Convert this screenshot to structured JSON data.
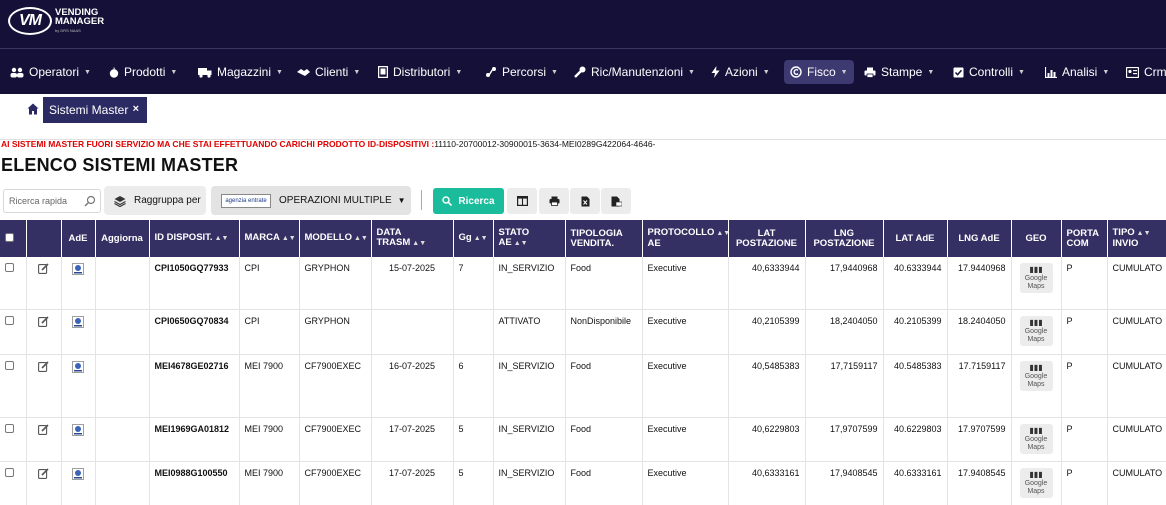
{
  "app": {
    "logo_mark": "VM",
    "logo_line1": "VENDING",
    "logo_line2": "MANAGER",
    "logo_sub": "by DRS NAAS"
  },
  "nav": {
    "items": [
      {
        "label": "Operatori",
        "icon": "users-icon"
      },
      {
        "label": "Prodotti",
        "icon": "apple-icon"
      },
      {
        "label": "Magazzini",
        "icon": "truck-icon"
      },
      {
        "label": "Clienti",
        "icon": "handshake-icon"
      },
      {
        "label": "Distributori",
        "icon": "tablet-icon"
      },
      {
        "label": "Percorsi",
        "icon": "route-icon"
      },
      {
        "label": "Ric/Manutenzioni",
        "icon": "wrench-icon"
      },
      {
        "label": "Azioni",
        "icon": "bolt-icon"
      },
      {
        "label": "Fisco",
        "icon": "copyright-icon"
      },
      {
        "label": "Stampe",
        "icon": "printer-icon"
      },
      {
        "label": "Controlli",
        "icon": "check-square-icon"
      },
      {
        "label": "Analisi",
        "icon": "bar-chart-icon"
      },
      {
        "label": "Crm",
        "icon": "id-card-icon"
      }
    ],
    "active": "Fisco"
  },
  "breadcrumb": {
    "tab_label": "Sistemi Master",
    "close": "×"
  },
  "alert": {
    "warning": "AI SISTEMI MASTER FUORI SERVIZIO MA CHE STAI EFFETTUANDO CARICHI PRODOTTO ID-DISPOSITIVI :",
    "ids": "11110-20700012-30900015-3634-MEI0289G422064-4646-"
  },
  "page_title": "ELENCO SISTEMI MASTER",
  "toolbar": {
    "search_placeholder": "Ricerca rapida",
    "group_label": "Raggruppa per",
    "ops_logo": "agenzia entrate",
    "ops_label": "OPERAZIONI MULTIPLE",
    "search_button": "Ricerca"
  },
  "table": {
    "columns": {
      "ade": "AdE",
      "aggiorna": "Aggiorna",
      "id": "ID DISPOSIT.",
      "marca": "MARCA",
      "modello": "MODELLO",
      "data": "DATA TRASM",
      "gg": "Gg",
      "stato": "STATO AE",
      "tipologia_1": "TIPOLOGIA",
      "tipologia_2": "VENDITA.",
      "protocollo_1": "PROTOCOLLO",
      "protocollo_2": "AE",
      "latpost_1": "LAT",
      "latpost_2": "POSTAZIONE",
      "lngpost_1": "LNG",
      "lngpost_2": "POSTAZIONE",
      "latade": "LAT AdE",
      "lngade": "LNG AdE",
      "geo": "GEO",
      "porta_1": "PORTA",
      "porta_2": "COM",
      "tipoinvio_1": "TIPO",
      "tipoinvio_2": "INVIO"
    },
    "gmaps_line1": "Google",
    "gmaps_line2": "Maps",
    "rows": [
      {
        "id": "CPI1050GQ77933",
        "marca": "CPI",
        "modello": "GRYPHON",
        "data": "15-07-2025",
        "gg": "7",
        "stato": "IN_SERVIZIO",
        "tipologia": "Food",
        "protocollo": "Executive",
        "lat_post": "40,6333944",
        "lng_post": "17,9440968",
        "lat_ade": "40.6333944",
        "lng_ade": "17.9440968",
        "porta": "P",
        "tipo_invio": "CUMULATO"
      },
      {
        "id": "CPI0650GQ70834",
        "marca": "CPI",
        "modello": "GRYPHON",
        "data": "",
        "gg": "",
        "stato": "ATTIVATO",
        "tipologia": "NonDisponibile",
        "protocollo": "Executive",
        "lat_post": "40,2105399",
        "lng_post": "18,2404050",
        "lat_ade": "40.2105399",
        "lng_ade": "18.2404050",
        "porta": "P",
        "tipo_invio": "CUMULATO"
      },
      {
        "id": "MEI4678GE02716",
        "marca": "MEI 7900",
        "modello": "CF7900EXEC",
        "data": "16-07-2025",
        "gg": "6",
        "stato": "IN_SERVIZIO",
        "tipologia": "Food",
        "protocollo": "Executive",
        "lat_post": "40,5485383",
        "lng_post": "17,7159117",
        "lat_ade": "40.5485383",
        "lng_ade": "17.7159117",
        "porta": "P",
        "tipo_invio": "CUMULATO"
      },
      {
        "id": "MEI1969GA01812",
        "marca": "MEI 7900",
        "modello": "CF7900EXEC",
        "data": "17-07-2025",
        "gg": "5",
        "stato": "IN_SERVIZIO",
        "tipologia": "Food",
        "protocollo": "Executive",
        "lat_post": "40,6229803",
        "lng_post": "17,9707599",
        "lat_ade": "40.6229803",
        "lng_ade": "17.9707599",
        "porta": "P",
        "tipo_invio": "CUMULATO"
      },
      {
        "id": "MEI0988G100550",
        "marca": "MEI 7900",
        "modello": "CF7900EXEC",
        "data": "17-07-2025",
        "gg": "5",
        "stato": "IN_SERVIZIO",
        "tipologia": "Food",
        "protocollo": "Executive",
        "lat_post": "40,6333161",
        "lng_post": "17,9408545",
        "lat_ade": "40.6333161",
        "lng_ade": "17.9408545",
        "porta": "P",
        "tipo_invio": "CUMULATO"
      }
    ]
  }
}
